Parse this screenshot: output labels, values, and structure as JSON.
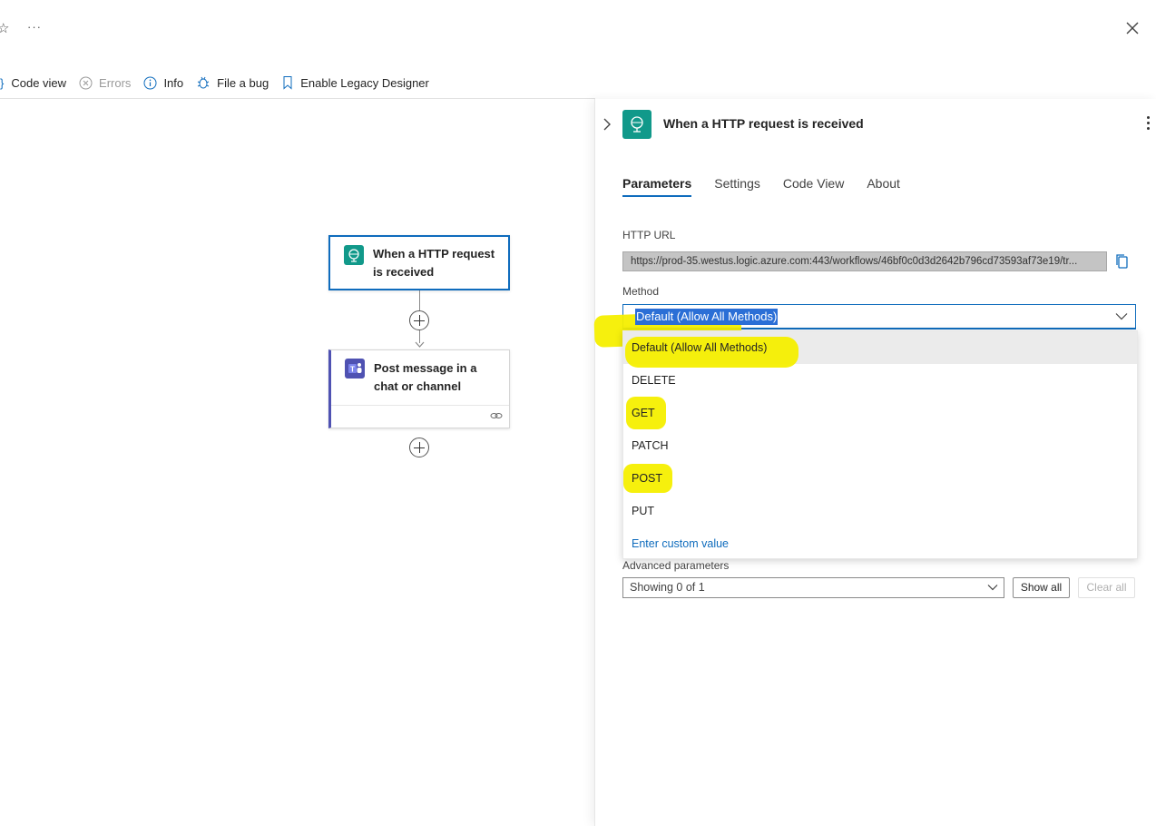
{
  "topbar": {
    "star_icon": "☆",
    "more_label": "···"
  },
  "toolbar": {
    "code_view": "Code view",
    "errors": "Errors",
    "info": "Info",
    "file_bug": "File a bug",
    "legacy": "Enable Legacy Designer"
  },
  "canvas": {
    "node1_line1": "When a HTTP request",
    "node1_line2": "is received",
    "node2_line1": "Post message in a",
    "node2_line2": "chat or channel"
  },
  "panel": {
    "title": "When a HTTP request is received",
    "tabs": [
      "Parameters",
      "Settings",
      "Code View",
      "About"
    ],
    "http_url_label": "HTTP URL",
    "http_url_value": "https://prod-35.westus.logic.azure.com:443/workflows/46bf0c0d3d2642b796cd73593af73e19/tr...",
    "method_label": "Method",
    "method_value": "Default (Allow All Methods)",
    "method_options": [
      "Default (Allow All Methods)",
      "DELETE",
      "GET",
      "PATCH",
      "POST",
      "PUT"
    ],
    "custom_value": "Enter custom value",
    "advanced_label": "Advanced parameters",
    "advanced_value": "Showing 0 of 1",
    "show_all": "Show all",
    "clear_all": "Clear all"
  },
  "colors": {
    "accent": "#0f6cbd",
    "trigger_icon": "#11998a",
    "teams_icon": "#4f52b2",
    "highlight": "#f5ef00"
  }
}
